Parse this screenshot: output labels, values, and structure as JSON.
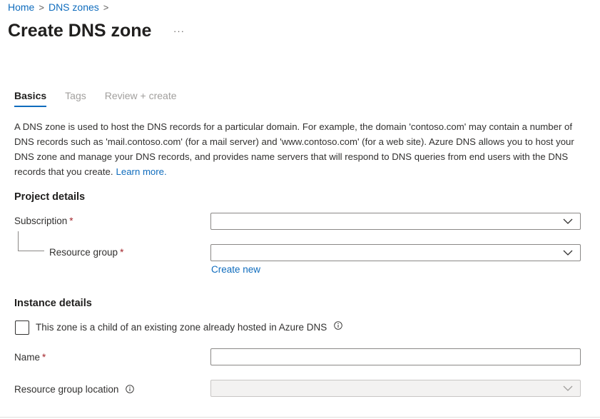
{
  "breadcrumb": {
    "home": "Home",
    "dns_zones": "DNS zones",
    "separator": ">"
  },
  "page": {
    "title": "Create DNS zone",
    "more": "···"
  },
  "tabs": [
    {
      "label": "Basics",
      "active": true
    },
    {
      "label": "Tags",
      "active": false
    },
    {
      "label": "Review + create",
      "active": false
    }
  ],
  "intro": {
    "text": "A DNS zone is used to host the DNS records for a particular domain. For example, the domain 'contoso.com' may contain a number of DNS records such as 'mail.contoso.com' (for a mail server) and 'www.contoso.com' (for a web site). Azure DNS allows you to host your DNS zone and manage your DNS records, and provides name servers that will respond to DNS queries from end users with the DNS records that you create.",
    "learn_more": "Learn more."
  },
  "project": {
    "heading": "Project details",
    "subscription_label": "Subscription",
    "subscription_value": "",
    "resource_group_label": "Resource group",
    "resource_group_value": "",
    "create_new": "Create new",
    "required_marker": "*"
  },
  "instance": {
    "heading": "Instance details",
    "child_zone_label": "This zone is a child of an existing zone already hosted in Azure DNS",
    "name_label": "Name",
    "name_value": "",
    "location_label": "Resource group location",
    "location_value": ""
  },
  "icons": {
    "chevron": "chevron-down-icon",
    "info": "info-icon"
  },
  "colors": {
    "accent": "#0f6cbd",
    "required": "#a4262c"
  }
}
